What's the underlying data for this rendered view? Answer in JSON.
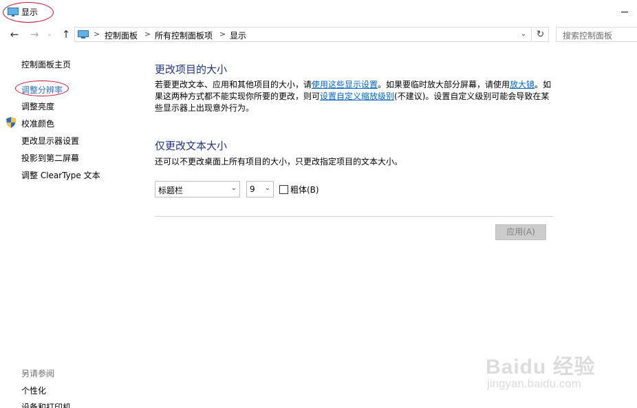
{
  "window": {
    "title": "显示"
  },
  "nav": {
    "back_icon": "back-arrow-icon",
    "forward_icon": "forward-arrow-icon",
    "up_icon": "up-arrow-icon",
    "breadcrumbs": [
      "控制面板",
      "所有控制面板项",
      "显示"
    ],
    "separator": ">",
    "dropdown_icon": "chevron-down-icon",
    "refresh_icon": "refresh-icon",
    "search_placeholder": "搜索控制面板"
  },
  "sidebar": {
    "home": "控制面板主页",
    "items": [
      "调整分辨率",
      "调整亮度",
      "校准颜色",
      "更改显示器设置",
      "投影到第二屏幕",
      "调整 ClearType 文本"
    ],
    "see_also_title": "另请参阅",
    "see_also": [
      "个性化",
      "设备和打印机"
    ]
  },
  "main": {
    "section1": {
      "title": "更改项目的大小",
      "p1": "若要更改文本、应用和其他项目的大小，请",
      "link1": "使用这些显示设置",
      "p2": "。如果要临时放大部分屏幕，请使用",
      "link2": "放大镜",
      "p3": "。如果这两种方式都不能实现你所要的更改，则可",
      "link3": "设置自定义缩放级别",
      "p4": "(不建议)。设置自定义级别可能会导致在某些显示器上出现意外行为。"
    },
    "section2": {
      "title": "仅更改文本大小",
      "desc": "还可以不更改桌面上所有项目的大小，只更改指定项目的文本大小。",
      "item_select": "标题栏",
      "size_select": "9",
      "bold_label": "粗体(B)",
      "bold_checked": false
    },
    "apply_label": "应用(A)"
  },
  "watermark": {
    "text": "Baidu 经验",
    "url": "jingyan.baidu.com"
  },
  "colors": {
    "title_blue": "#1e3287",
    "link_blue": "#0066cc",
    "annotation_red": "#c8102e"
  }
}
